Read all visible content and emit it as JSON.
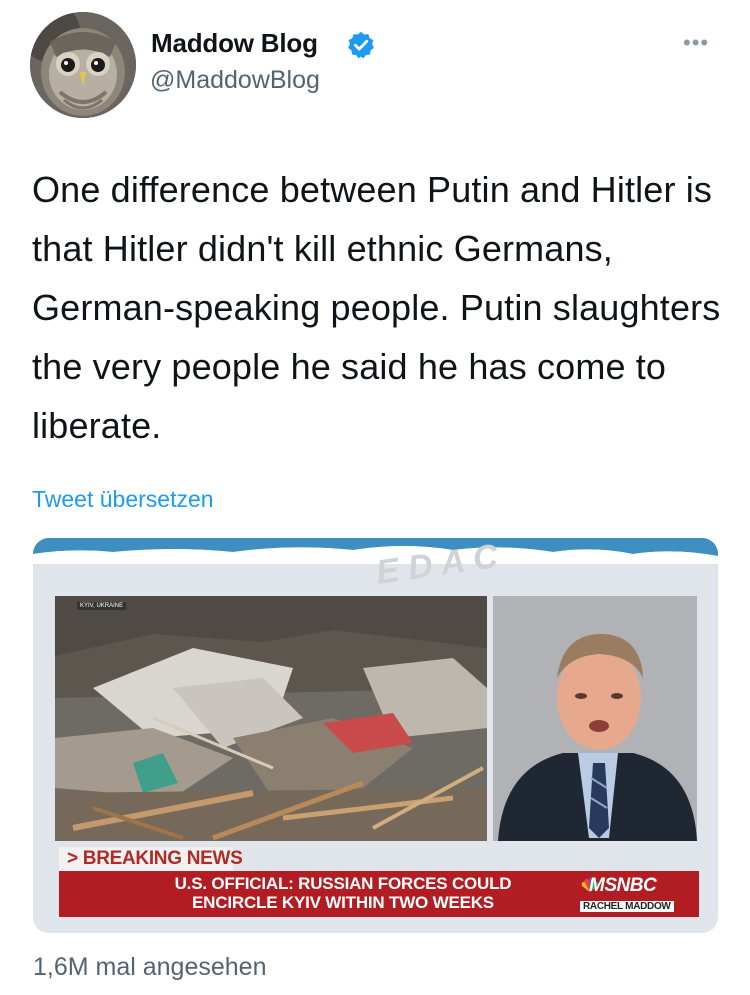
{
  "author": {
    "display_name": "Maddow Blog",
    "handle": "@MaddowBlog",
    "avatar": "owl-avatar",
    "verified_icon": "verified-badge-icon",
    "more_icon": "more-options-icon",
    "more_glyph": "•••"
  },
  "tweet": {
    "text": "One difference between Putin and Hitler is that Hitler didn't kill ethnic Germans, German-speaking people. Putin slaughters the very people he said he has come to liberate.",
    "translate_link": "Tweet übersetzen"
  },
  "media": {
    "place_tag": "KYIV, UKRAINE",
    "breaking_label": "> BREAKING NEWS",
    "headline_line1": "U.S. OFFICIAL: RUSSIAN FORCES COULD",
    "headline_line2": "ENCIRCLE KYIV WITHIN TWO WEEKS",
    "network": "MSNBC",
    "show": "RACHEL MADDOW",
    "network_icon": "peacock-icon"
  },
  "footer": {
    "views": "1,6M mal angesehen"
  },
  "colors": {
    "accent": "#1d9bf0",
    "text": "#0f1419",
    "muted": "#536471",
    "chyron_red": "#b11d23"
  }
}
